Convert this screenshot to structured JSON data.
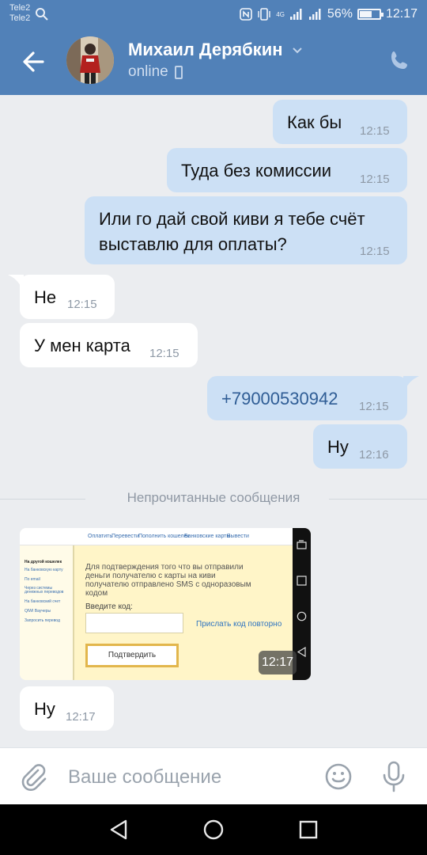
{
  "status_bar": {
    "carrier1": "Tele2",
    "carrier2": "Tele2",
    "network": "4G",
    "battery_percent": "56%",
    "battery_level": 0.56,
    "clock": "12:17"
  },
  "header": {
    "name": "Михаил Дерябкин",
    "status": "online",
    "accent_color": "#5181b8"
  },
  "messages": [
    {
      "side": "out",
      "text": "Как бы",
      "time": "12:15"
    },
    {
      "side": "out",
      "text": "Туда без комиссии",
      "time": "12:15"
    },
    {
      "side": "out",
      "text_line1": "Или го дай свой киви я тебе счёт",
      "text_line2": "выставлю для оплаты?",
      "time": "12:15"
    },
    {
      "side": "in",
      "text": "Не",
      "time": "12:15"
    },
    {
      "side": "in",
      "text": "У мен карта",
      "time": "12:15"
    },
    {
      "side": "out",
      "text": "+79000530942",
      "time": "12:15"
    },
    {
      "side": "out",
      "text": "Ну",
      "time": "12:16"
    },
    {
      "side": "in",
      "text": "Ну",
      "time": "12:17"
    }
  ],
  "unread_divider": "Непрочитанные сообщения",
  "photo": {
    "time": "12:17",
    "tabs": [
      "Оплатить",
      "Перевести",
      "Пополнить кошелек",
      "Банковские карты",
      "Вывести"
    ],
    "sidebar": [
      "На другой кошелек",
      "На банковскую карту",
      "По email",
      "Через системы денежных переводов",
      "На банковский счет",
      "QIWI Ваучеры",
      "Запросить перевод"
    ],
    "message": "Для подтверждения того что вы отправили деньги получателю с карты на киви получателю отправлено SMS с одноразовым кодом",
    "code_label": "Введите код:",
    "resend_link": "Прислать код повторно",
    "confirm_button": "Подтвердить"
  },
  "composer": {
    "placeholder": "Ваше сообщение"
  },
  "icons": {
    "back": "arrow-left-icon",
    "call": "phone-icon",
    "attach": "paperclip-icon",
    "emoji": "smile-icon",
    "voice": "microphone-icon"
  }
}
